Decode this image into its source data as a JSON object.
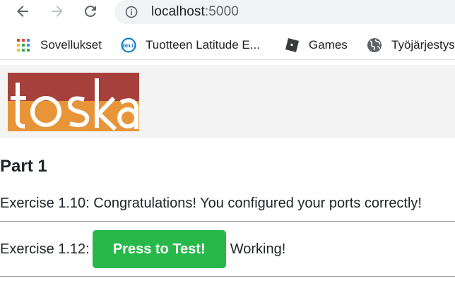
{
  "browser": {
    "address_host": "localhost",
    "address_port": ":5000",
    "bookmarks": [
      {
        "label": "Sovellukset",
        "icon": "apps-grid-icon"
      },
      {
        "label": "Tuotteen Latitude E...",
        "icon": "dell-logo-icon"
      },
      {
        "label": "Games",
        "icon": "roblox-icon"
      },
      {
        "label": "Työjärjestys",
        "icon": "globe-icon"
      }
    ]
  },
  "page": {
    "logo_text": "toska",
    "heading": "Part 1",
    "exercise_110": "Exercise 1.10: Congratulations! You configured your ports correctly!",
    "exercise_112_label": "Exercise 1.12:",
    "test_button_label": "Press to Test!",
    "status_text": "Working!"
  },
  "colors": {
    "button_green": "#28b84a",
    "logo_red": "#a6403a",
    "logo_orange": "#e8953a",
    "banner_bg": "#f4f4f4"
  }
}
